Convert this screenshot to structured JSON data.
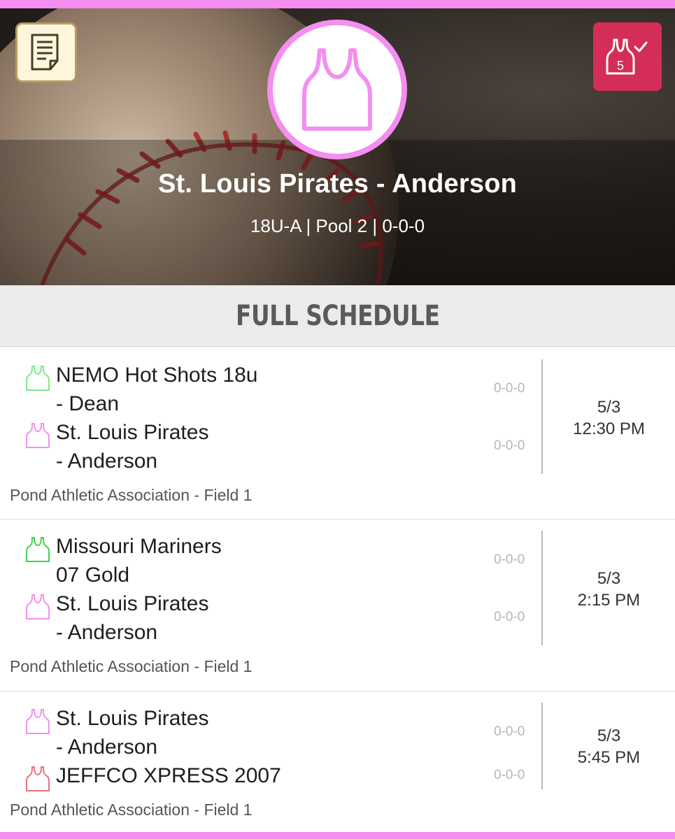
{
  "header": {
    "team_name": "St. Louis Pirates - Anderson",
    "subtitle": "18U-A | Pool 2 | 0-0-0",
    "logo_color": "#f48ef0",
    "notes_icon": "notes-icon",
    "checkin_icon": "jersey-check-icon",
    "checkin_badge": "5",
    "checkin_color": "#d42d57"
  },
  "schedule": {
    "title": "FULL SCHEDULE",
    "games": [
      {
        "home": {
          "name_line1": "NEMO Hot Shots 18u",
          "name_line2": "- Dean",
          "record": "0-0-0",
          "jersey_color": "#7ee88a"
        },
        "away": {
          "name_line1": "St. Louis Pirates",
          "name_line2": "- Anderson",
          "record": "0-0-0",
          "jersey_color": "#f48ef0"
        },
        "date": "5/3",
        "time": "12:30 PM",
        "venue": "Pond Athletic Association - Field 1"
      },
      {
        "home": {
          "name_line1": "Missouri Mariners",
          "name_line2": "07 Gold",
          "record": "0-0-0",
          "jersey_color": "#3fd24e"
        },
        "away": {
          "name_line1": "St. Louis Pirates",
          "name_line2": "- Anderson",
          "record": "0-0-0",
          "jersey_color": "#f48ef0"
        },
        "date": "5/3",
        "time": "2:15 PM",
        "venue": "Pond Athletic Association - Field 1"
      },
      {
        "home": {
          "name_line1": "St. Louis Pirates",
          "name_line2": "- Anderson",
          "record": "0-0-0",
          "jersey_color": "#f48ef0"
        },
        "away": {
          "name_line1": "JEFFCO XPRESS 2007",
          "name_line2": "",
          "record": "0-0-0",
          "jersey_color": "#e8737a"
        },
        "date": "5/3",
        "time": "5:45 PM",
        "venue": "Pond Athletic Association - Field 1"
      }
    ]
  }
}
